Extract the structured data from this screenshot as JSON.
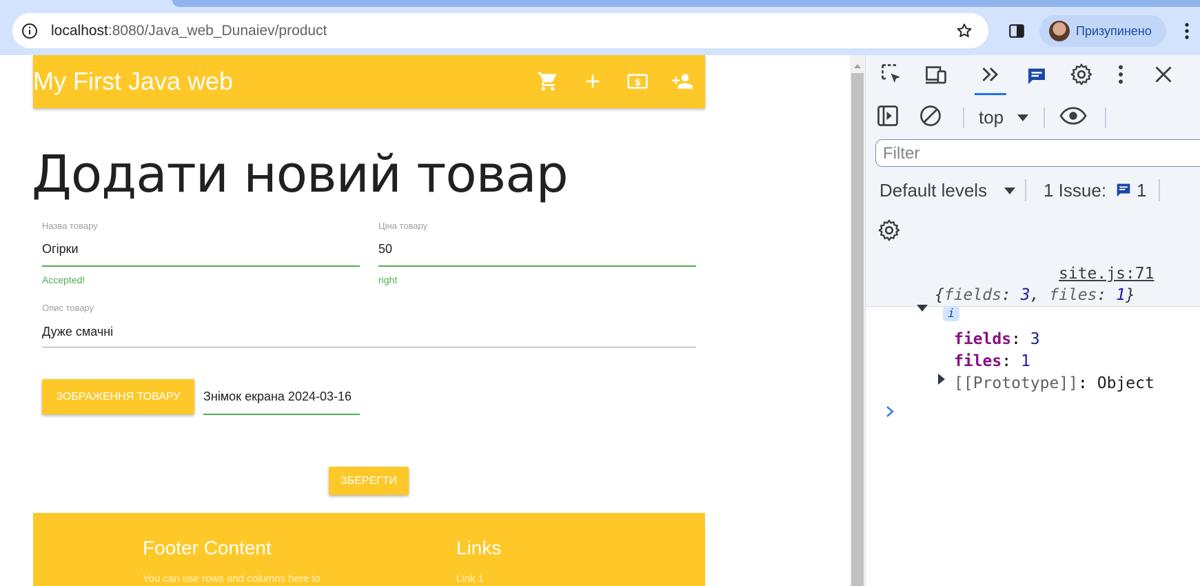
{
  "browser": {
    "url_host": "localhost",
    "url_path": ":8080/Java_web_Dunaiev/product",
    "profile_label": "Призупинено"
  },
  "page": {
    "brand": "My First Java web",
    "nav_icons": [
      "cart-icon",
      "add-icon",
      "money-icon",
      "person-add-icon"
    ],
    "heading": "Додати новий товар",
    "form": {
      "name": {
        "label": "Назва товару",
        "value": "Огірки",
        "helper": "Accepted!"
      },
      "price": {
        "label": "Ціна товару",
        "value": "50",
        "helper": "right"
      },
      "description": {
        "label": "Опис товару",
        "value": "Дуже смачні"
      },
      "image_button": "ЗОБРАЖЕННЯ ТОВАРУ",
      "image_filename": "Знімок екрана 2024-03-16",
      "save_button": "ЗБЕРЕГТИ"
    },
    "footer": {
      "title": "Footer Content",
      "text": "You can use rows and columns here to",
      "links_title": "Links",
      "link1": "Link 1"
    }
  },
  "devtools": {
    "context": "top",
    "filter_placeholder": "Filter",
    "levels": "Default levels",
    "issues_label": "1 Issue:",
    "issues_count": "1",
    "console": {
      "source_link": "site.js:71",
      "summary_open": "{",
      "summary_k1": "fields",
      "summary_v1": "3",
      "summary_k2": "files",
      "summary_v2": "1",
      "summary_close": "}",
      "info_badge": "i",
      "prop1_key": "fields",
      "prop1_value": "3",
      "prop2_key": "files",
      "prop2_value": "1",
      "proto_key": "[[Prototype]]",
      "proto_value": "Object"
    }
  },
  "colors": {
    "brand_yellow": "#fec828",
    "success_green": "#4caf50",
    "devtools_blue": "#1a73e8"
  }
}
